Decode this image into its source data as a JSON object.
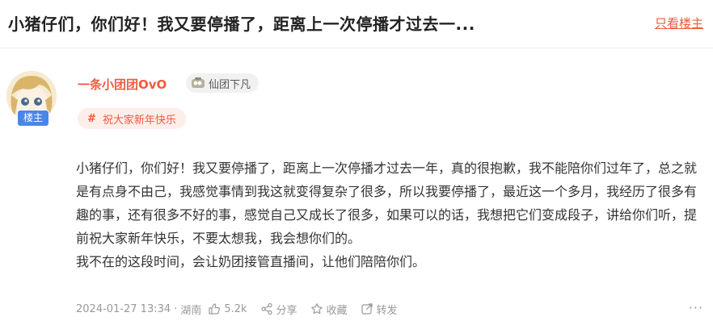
{
  "header": {
    "title": "小猪仔们，你们好！我又要停播了，距离上一次停播才过去一...",
    "only_op_label": "只看楼主"
  },
  "author": {
    "name": "一条小团团OvO",
    "op_badge": "楼主",
    "level_badge": "仙团下凡",
    "topic_tag": "祝大家新年快乐"
  },
  "post": {
    "paragraphs": [
      "小猪仔们，你们好！我又要停播了，距离上一次停播才过去一年，真的很抱歉，我不能陪你们过年了，总之就是有点身不由己，我感觉事情到我这就变得复杂了很多，所以我要停播了，最近这一个多月，我经历了很多有趣的事，还有很多不好的事，感觉自己又成长了很多，如果可以的话，我想把它们变成段子，讲给你们听，提前祝大家新年快乐，不要太想我，我会想你们的。",
      "我不在的这段时间，会让奶团接管直播间，让他们陪陪你们。"
    ]
  },
  "meta": {
    "datetime": "2024-01-27 13:34",
    "location": "湖南",
    "likes": "5.2k",
    "share_label": "分享",
    "favorite_label": "收藏",
    "repost_label": "转发",
    "more_label": "···"
  },
  "colors": {
    "accent": "#ee5b3d",
    "op_badge_bg": "#4a86e8"
  },
  "icons": {
    "like": "thumbs-up-icon",
    "share": "share-icon",
    "favorite": "star-icon",
    "repost": "repost-icon",
    "level": "cloud-badge-icon"
  }
}
